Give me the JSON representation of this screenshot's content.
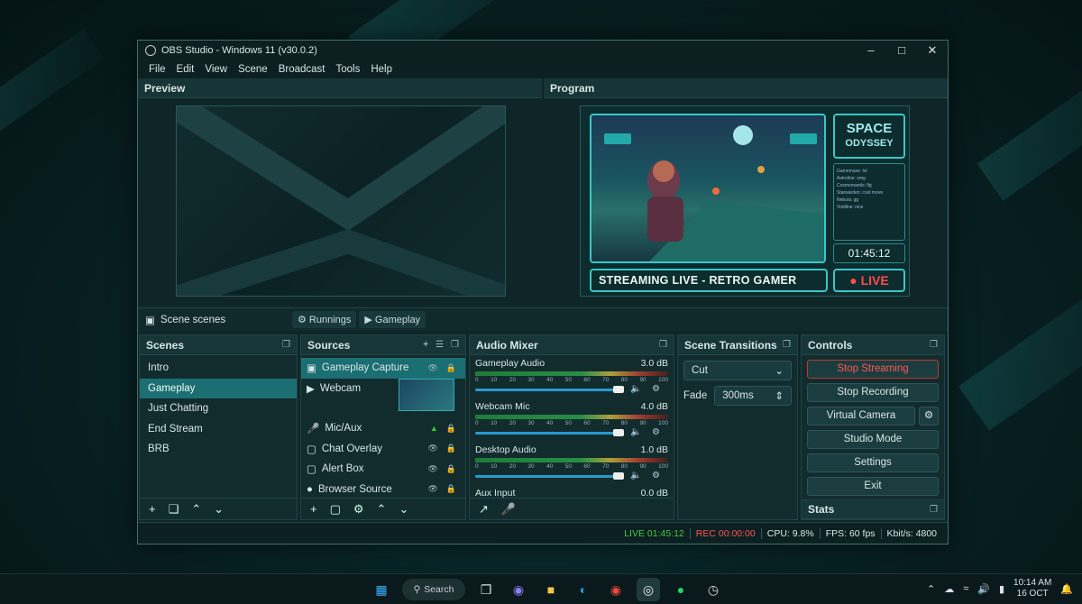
{
  "window": {
    "title": "OBS Studio - Windows 11 (v30.0.2)"
  },
  "menu": [
    "File",
    "Edit",
    "View",
    "Scene",
    "Broadcast",
    "Tools",
    "Help"
  ],
  "preview": {
    "title": "Preview"
  },
  "program": {
    "title": "Program",
    "brand_line1": "SPACE",
    "brand_line2": "ODYSSEY",
    "timer": "01:45:12",
    "banner": "STREAMING LIVE - RETRO GAMER",
    "live": "● LIVE",
    "chat": [
      "Gamemuse: lol",
      "Astroline: omg",
      "Cosmomantis: lfg",
      "Starwarden: cool move",
      "Nebula: gg",
      "Voidline: nice"
    ]
  },
  "scenebar": {
    "label": "Scene scenes",
    "chip1": "Runnings",
    "chip2": "Gameplay"
  },
  "scenes": {
    "title": "Scenes",
    "items": [
      "Intro",
      "Gameplay",
      "Just Chatting",
      "End Stream",
      "BRB"
    ]
  },
  "sources": {
    "title": "Sources",
    "items": [
      "Gameplay Capture",
      "Webcam",
      "Mic/Aux",
      "Chat Overlay",
      "Alert Box",
      "Browser Source"
    ]
  },
  "mixer": {
    "title": "Audio Mixer",
    "tracks": [
      {
        "name": "Gameplay Audio",
        "db": "3.0 dB"
      },
      {
        "name": "Webcam Mic",
        "db": "4.0 dB"
      },
      {
        "name": "Desktop Audio",
        "db": "1.0 dB"
      },
      {
        "name": "Aux Input",
        "db": "0.0 dB"
      }
    ],
    "ticks": [
      "0",
      "10",
      "20",
      "30",
      "40",
      "50",
      "60",
      "70",
      "80",
      "90",
      "100"
    ]
  },
  "transitions": {
    "title": "Scene Transitions",
    "type": "Cut",
    "fade_label": "Fade",
    "fade_value": "300ms"
  },
  "controls": {
    "title": "Controls",
    "buttons": [
      "Stop Streaming",
      "Stop Recording",
      "Virtual Camera",
      "Studio Mode",
      "Settings",
      "Exit"
    ]
  },
  "stats": {
    "title": "Stats"
  },
  "status": {
    "live": "LIVE 01:45:12",
    "rec": "REC 00:00:00",
    "cpu": "CPU: 9.8%",
    "fps": "FPS: 60 fps",
    "kbps": "Kbit/s: 4800"
  },
  "taskbar": {
    "search": "Search",
    "time": "10:14 AM",
    "date": "16 OCT"
  }
}
